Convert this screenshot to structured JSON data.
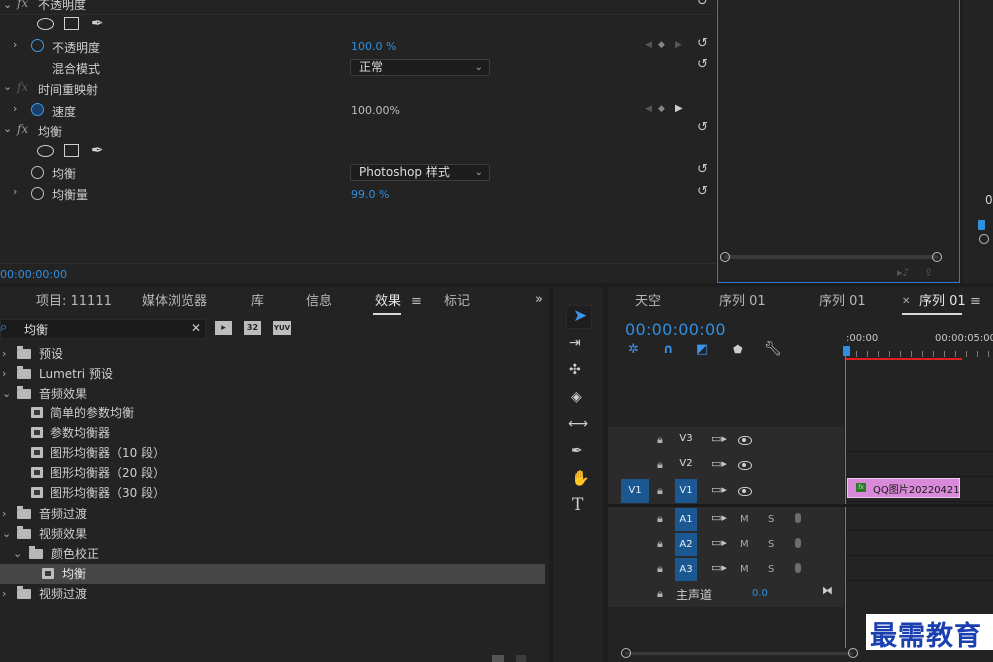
{
  "effect_controls": {
    "opacity_group": "不透明度",
    "opacity_param": "不透明度",
    "opacity_value": "100.0 %",
    "blend_label": "混合模式",
    "blend_value": "正常",
    "time_remap": "时间重映射",
    "speed_label": "速度",
    "speed_value": "100.00%",
    "equalize_group": "均衡",
    "equalize_param": "均衡",
    "equalize_mode": "Photoshop 样式",
    "equalize_amount_label": "均衡量",
    "equalize_amount_value": "99.0 %",
    "timecode": "00:00:00:00",
    "fx_label": "fx"
  },
  "right_monitor": {
    "value": "0"
  },
  "project_tabs": [
    {
      "label": "项目: 11111"
    },
    {
      "label": "媒体浏览器"
    },
    {
      "label": "库"
    },
    {
      "label": "信息"
    },
    {
      "label": "效果"
    },
    {
      "label": "标记"
    }
  ],
  "effects_panel": {
    "search_value": "均衡",
    "filter_icons": [
      "32",
      "YUV"
    ],
    "tree": [
      {
        "label": "预设"
      },
      {
        "label": "Lumetri 预设"
      },
      {
        "label": "音频效果"
      },
      {
        "label": "简单的参数均衡"
      },
      {
        "label": "参数均衡器"
      },
      {
        "label": "图形均衡器（10 段）"
      },
      {
        "label": "图形均衡器（20 段）"
      },
      {
        "label": "图形均衡器（30 段）"
      },
      {
        "label": "音频过渡"
      },
      {
        "label": "视频效果"
      },
      {
        "label": "颜色校正"
      },
      {
        "label": "均衡"
      },
      {
        "label": "视频过渡"
      }
    ]
  },
  "timeline": {
    "tabs": [
      {
        "label": "天空"
      },
      {
        "label": "序列 01"
      },
      {
        "label": "序列 01"
      },
      {
        "label": "序列 01"
      }
    ],
    "timecode": "00:00:00:00",
    "ruler_labels": [
      ":00:00",
      "00:00:05:00"
    ],
    "tracks_video": [
      "V3",
      "V2",
      "V1"
    ],
    "source_v1": "V1",
    "tracks_audio": [
      "A1",
      "A2",
      "A3"
    ],
    "track_m": "M",
    "track_s": "S",
    "master_label": "主声道",
    "master_value": "0.0",
    "clip_label": "QQ图片20220421",
    "clip_badge": "fx"
  },
  "watermark": "最需教育",
  "colors": {
    "accent_blue": "#2f8fe0",
    "track_on_blue": "#1b5791",
    "clip_pink": "#d88ad8",
    "playhead_red": "#e02020"
  }
}
